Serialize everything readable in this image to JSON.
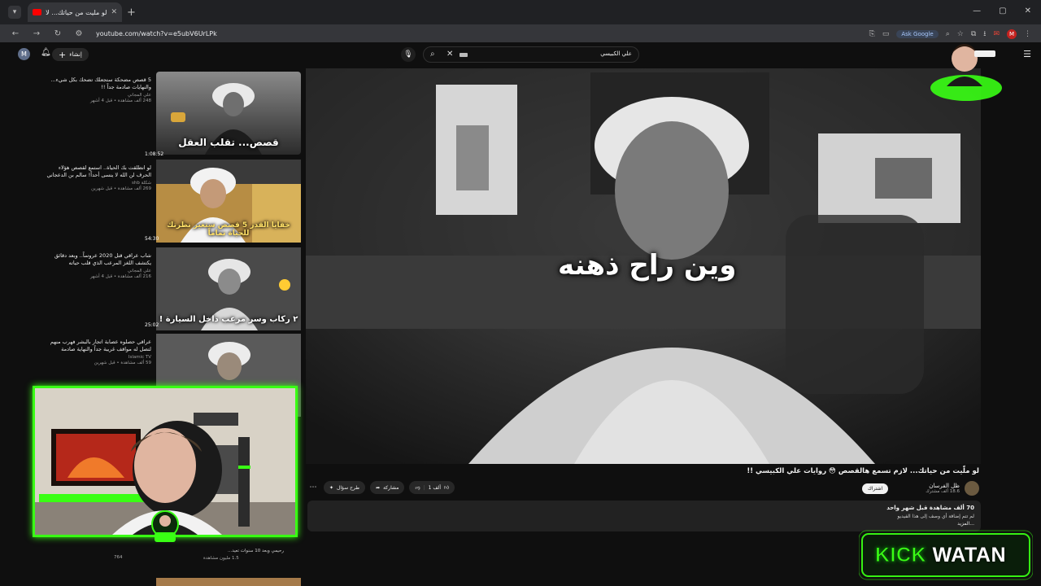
{
  "browser": {
    "tab_title": "لو ملّيت من حياتك... لازم تسم...",
    "url": "youtube.com/watch?v=e5ubV6UrLPk",
    "ask_google": "Ask Google",
    "profile_letter": "M"
  },
  "header": {
    "avatar_letter": "M",
    "create_label": "إنشاء",
    "search_query": "علي الكبيسي"
  },
  "recommendations": [
    {
      "title": "5 قصص مضحكة ستجعلك تضحك بكل شيء... والنهايات صادمة جداً !!",
      "channel": "علي المجاني",
      "views": "248 ألف مشاهدة • قبل 4 أشهر",
      "thumb_caption": "قصص... تقلب العقل",
      "duration": ""
    },
    {
      "title": "لو انطلقت بك الحياة.. استمع لقصص هؤلاء الحرف لن الله لا ينسى أحداً! سالم بن الدعجاني",
      "channel": "شكلة shb",
      "views": "269 ألف مشاهدة • قبل شهرين",
      "thumb_caption": "خفايا القدر 5 قصص ستغير نظرتك للحياة تماماً",
      "duration": "1:08:52"
    },
    {
      "title": "شاب عراقي قتل 2020 عروساً.. وبعد دقائق يكتشف اللغز المرعب الذي قلب حياته",
      "channel": "علي المجاني",
      "views": "216 ألف مشاهدة • قبل 4 أشهر",
      "thumb_caption": "٢ ركاب وسر مرعب داخل السيارة !",
      "duration": "54:30"
    },
    {
      "title": "عراقي حصلوه عصابة اتجار بالبشر فهرب منهم لتصل له مواقف غريبة جداً والنهاية صادمة",
      "channel": "Islamic TV",
      "views": "59 ألف مشاهدة • قبل شهرين",
      "thumb_caption": "",
      "duration": "25:02"
    }
  ],
  "video": {
    "subtitle": "وين راح ذهنه",
    "title": "لو ملّيت من حياتك... لازم تسمع هالقصص 😳 روايات علي الكبيسي !!",
    "channel": "ظل الفرسان",
    "subscribers": "18.6 ألف مشترك",
    "subscribe_label": "اشتراك",
    "like_count": "1 ألف",
    "share_label": "مشاركة",
    "ask_label": "طرح سؤال",
    "views_line": "70 ألف مشاهدة قبل شهر واحد",
    "desc_line1": "لم تتم إضافة أي وصف إلى هذا الفيديو",
    "desc_line2": "...المزيد"
  },
  "under_cam": {
    "line_left_a": "764",
    "line_left_b": "1.5 مليون مشاهدة",
    "line_mid": "رحيمي وبعد 10 سنوات تعيد...",
    "line_right": "1.5 مليون مشاهدة"
  },
  "kick": {
    "word1": "KICK",
    "word2": "WATAN"
  }
}
